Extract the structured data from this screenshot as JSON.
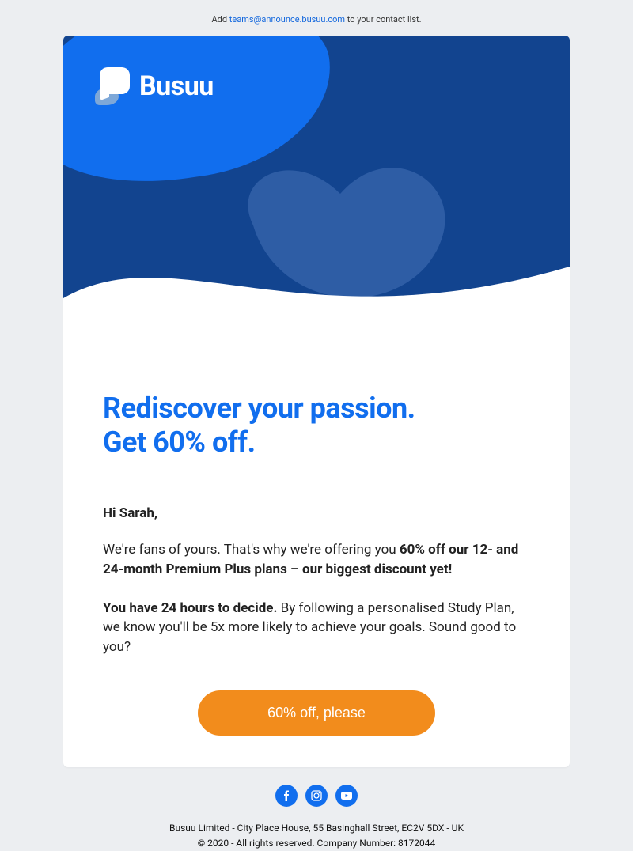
{
  "preheader": {
    "prefix": "Add ",
    "email": "teams@announce.busuu.com",
    "suffix": " to your contact list."
  },
  "brand": {
    "name": "Busuu"
  },
  "headline": {
    "line1": "Rediscover your passion.",
    "line2": "Get 60% off."
  },
  "greeting": "Hi Sarah,",
  "para1": {
    "prefix": "We're fans of yours. That's why we're offering you ",
    "bold": "60% off our 12- and 24-month Premium Plus plans – our biggest discount yet!"
  },
  "para2": {
    "bold": "You have 24 hours to decide.",
    "rest": " By following a personalised Study Plan, we know you'll be 5x more likely to achieve your goals. Sound good to you?"
  },
  "cta_label": "60% off, please",
  "footer": {
    "address": "Busuu Limited - City Place House, 55 Basinghall Street, EC2V 5DX - UK",
    "copyright": "© 2020 - All rights reserved. Company Number: 8172044"
  },
  "colors": {
    "brand_blue": "#116EEE",
    "hero_blue": "#12448f",
    "cta_orange": "#F28C1C"
  }
}
